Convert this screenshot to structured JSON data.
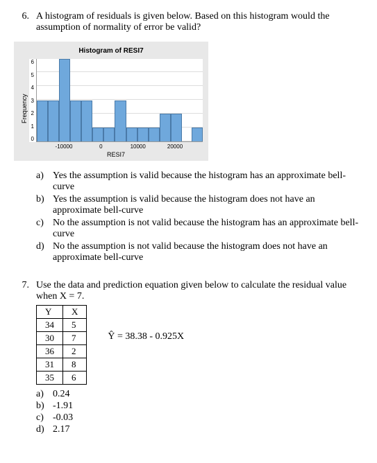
{
  "q6": {
    "number": "6.",
    "text": "A histogram of residuals is given below. Based on this histogram would the assumption of normality of error be valid?",
    "options": {
      "a": {
        "label": "a)",
        "text": "Yes the assumption is valid because the histogram has an approximate bell-curve"
      },
      "b": {
        "label": "b)",
        "text": "Yes the assumption is valid because the histogram does not have an approximate bell-curve"
      },
      "c": {
        "label": "c)",
        "text": "No the assumption is not valid because the histogram has an approximate bell-curve"
      },
      "d": {
        "label": "d)",
        "text": "No the assumption is not valid because the histogram does not have an approximate bell-curve"
      }
    }
  },
  "q7": {
    "number": "7.",
    "text": "Use the data and prediction equation given below to calculate the residual value when X = 7.",
    "table": {
      "headY": "Y",
      "headX": "X",
      "r1y": "34",
      "r1x": "5",
      "r2y": "30",
      "r2x": "7",
      "r3y": "36",
      "r3x": "2",
      "r4y": "31",
      "r4x": "8",
      "r5y": "35",
      "r5x": "6"
    },
    "equation": "Ŷ = 38.38 - 0.925X",
    "options": {
      "a": {
        "label": "a)",
        "text": "0.24"
      },
      "b": {
        "label": "b)",
        "text": "-1.91"
      },
      "c": {
        "label": "c)",
        "text": "-0.03"
      },
      "d": {
        "label": "d)",
        "text": "2.17"
      }
    }
  },
  "chart_data": {
    "type": "bar",
    "title": "Histogram of RESI7",
    "xlabel": "RESI7",
    "ylabel": "Frequency",
    "ylim": [
      0,
      6
    ],
    "yticks": [
      "6",
      "5",
      "4",
      "3",
      "2",
      "1",
      "0"
    ],
    "xticks": [
      "-10000",
      "0",
      "10000",
      "20000"
    ],
    "categories": [
      "-15000",
      "-12500",
      "-10000",
      "-7500",
      "-5000",
      "-2500",
      "0",
      "2500",
      "5000",
      "7500",
      "10000",
      "12500",
      "15000",
      "17500",
      "20000"
    ],
    "values": [
      3,
      3,
      6,
      3,
      3,
      1,
      1,
      3,
      1,
      1,
      1,
      2,
      2,
      0,
      1
    ]
  }
}
